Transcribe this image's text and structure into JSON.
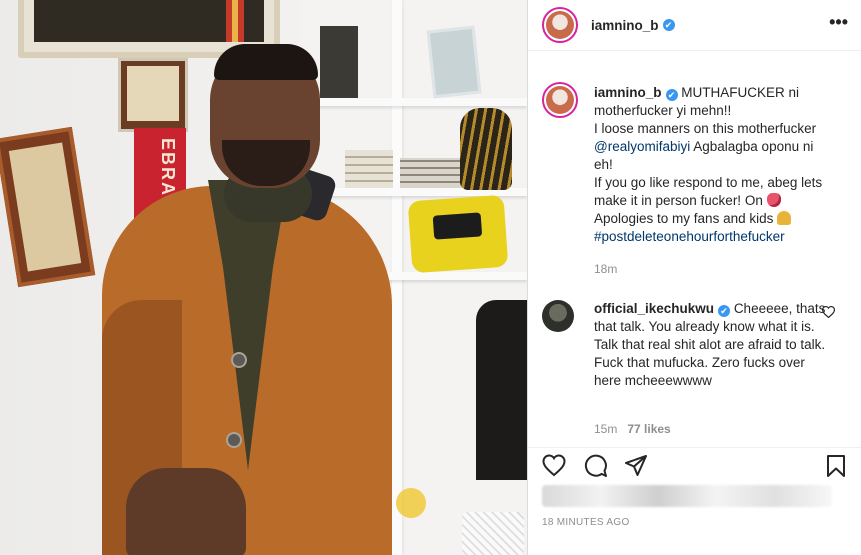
{
  "post": {
    "username": "iamnino_b",
    "verified_mark": "✔",
    "more_icon": "•••",
    "caption_lines": [
      "MUTHAFUCKER ni",
      "motherfucker yi mehn!!",
      "I loose manners on this motherfucker",
      "Agbalagba oponu ni",
      "eh!",
      "If you go like respond to me, abeg lets",
      "make it in person fucker! On",
      "Apologies to my fans and kids"
    ],
    "mention": "@realyomifabiyi",
    "hashtag": "#postdeleteonehourforthefucker",
    "caption_time": "18m",
    "timestamp": "18 MINUTES AGO"
  },
  "comment": {
    "username": "official_ikechukwu",
    "text_lines": [
      "Cheeeee,",
      "thats that talk. You already know",
      "what it is. Talk that real shit alot",
      "are afraid to talk. Fuck that",
      "mufucka. Zero fucks over here",
      "mcheeewwww"
    ],
    "time": "15m",
    "likes": "77 likes"
  },
  "photo": {
    "sash_text": "EBRATION"
  },
  "colors": {
    "link": "#00376b",
    "muted": "#8e8e8e",
    "verified": "#3897f0",
    "coat": "#b96b2a"
  },
  "icons": [
    "more-icon",
    "verified-icon",
    "heart-icon",
    "comment-icon",
    "share-icon",
    "bookmark-icon"
  ]
}
